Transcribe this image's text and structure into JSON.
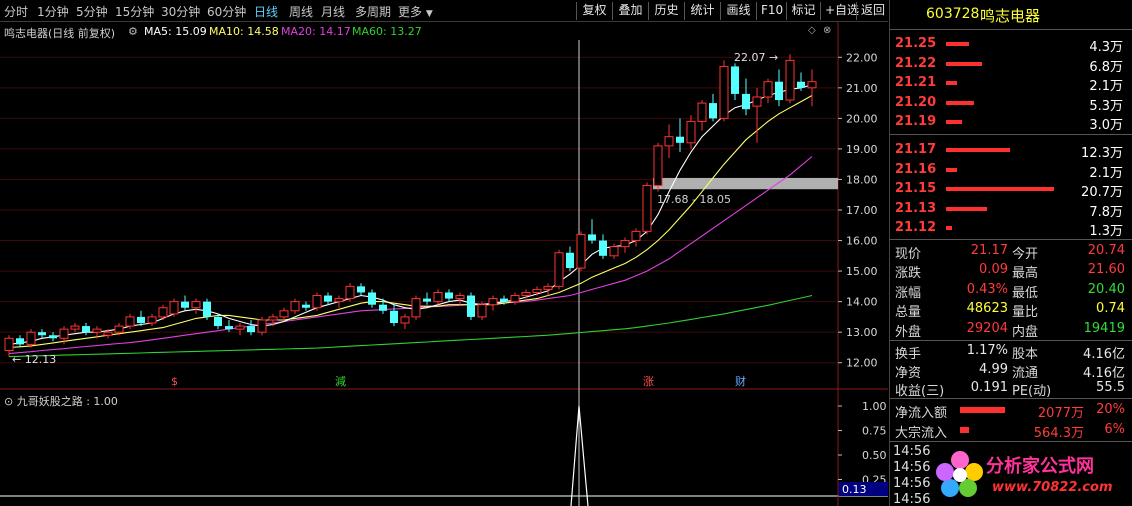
{
  "periods": [
    "分时",
    "1分钟",
    "5分钟",
    "15分钟",
    "30分钟",
    "60分钟",
    "日线",
    "周线",
    "月线",
    "多周期",
    "更多"
  ],
  "active_period": "日线",
  "toolbar": [
    "复权",
    "叠加",
    "历史",
    "统计",
    "画线",
    "F10",
    "标记",
    "+自选",
    "返回"
  ],
  "stock": {
    "code": "603728",
    "name": "鸣志电器",
    "chart_title": "鸣志电器(日线 前复权)"
  },
  "ma": {
    "ma5": {
      "label": "MA5: 15.09",
      "color": "#ffffff"
    },
    "ma10": {
      "label": "MA10: 14.58",
      "color": "#ffff66"
    },
    "ma20": {
      "label": "MA20: 14.17",
      "color": "#e040e0"
    },
    "ma60": {
      "label": "MA60: 13.27",
      "color": "#30d030"
    }
  },
  "annotations": {
    "high": "22.07",
    "low": "12.13",
    "band": "17.68 - 18.05"
  },
  "events": [
    "$",
    "減",
    "涨",
    "财"
  ],
  "indicator": {
    "label": "九哥妖股之路 : 1.00",
    "y_labels": [
      "1.00",
      "0.75",
      "0.50",
      "0.25"
    ],
    "current": "0.13"
  },
  "chart_data": {
    "type": "candlestick",
    "ylim": [
      11.5,
      22.5
    ],
    "y_ticks": [
      "22.00",
      "21.00",
      "20.00",
      "19.00",
      "18.00",
      "17.00",
      "16.00",
      "15.00",
      "14.00",
      "13.00",
      "12.00"
    ],
    "candles": [
      [
        12.4,
        12.9,
        12.2,
        12.8
      ],
      [
        12.8,
        12.9,
        12.5,
        12.6
      ],
      [
        12.6,
        13.1,
        12.5,
        13.0
      ],
      [
        13.0,
        13.1,
        12.8,
        12.9
      ],
      [
        12.9,
        13.0,
        12.7,
        12.8
      ],
      [
        12.8,
        13.2,
        12.6,
        13.1
      ],
      [
        13.1,
        13.3,
        13.0,
        13.2
      ],
      [
        13.2,
        13.3,
        12.9,
        13.0
      ],
      [
        13.0,
        13.2,
        12.8,
        13.1
      ],
      [
        12.9,
        13.1,
        12.8,
        13.0
      ],
      [
        13.0,
        13.3,
        12.9,
        13.2
      ],
      [
        13.2,
        13.6,
        13.1,
        13.5
      ],
      [
        13.5,
        13.7,
        13.2,
        13.3
      ],
      [
        13.3,
        13.6,
        13.2,
        13.5
      ],
      [
        13.5,
        13.9,
        13.4,
        13.8
      ],
      [
        13.6,
        14.1,
        13.5,
        14.0
      ],
      [
        14.0,
        14.2,
        13.7,
        13.8
      ],
      [
        13.8,
        14.1,
        13.6,
        14.0
      ],
      [
        14.0,
        14.1,
        13.4,
        13.5
      ],
      [
        13.5,
        13.6,
        13.1,
        13.2
      ],
      [
        13.2,
        13.4,
        13.0,
        13.1
      ],
      [
        13.1,
        13.3,
        12.9,
        13.2
      ],
      [
        13.2,
        13.4,
        12.9,
        13.0
      ],
      [
        13.0,
        13.5,
        12.9,
        13.4
      ],
      [
        13.4,
        13.6,
        13.2,
        13.5
      ],
      [
        13.5,
        13.8,
        13.4,
        13.7
      ],
      [
        13.7,
        14.1,
        13.6,
        14.0
      ],
      [
        13.9,
        14.0,
        13.7,
        13.8
      ],
      [
        13.8,
        14.3,
        13.7,
        14.2
      ],
      [
        14.2,
        14.3,
        13.9,
        14.0
      ],
      [
        14.0,
        14.2,
        13.8,
        14.1
      ],
      [
        14.1,
        14.6,
        14.0,
        14.5
      ],
      [
        14.5,
        14.6,
        14.2,
        14.3
      ],
      [
        14.3,
        14.4,
        13.8,
        13.9
      ],
      [
        13.9,
        14.1,
        13.6,
        13.7
      ],
      [
        13.7,
        13.9,
        13.2,
        13.3
      ],
      [
        13.3,
        13.6,
        13.1,
        13.5
      ],
      [
        13.5,
        14.2,
        13.4,
        14.1
      ],
      [
        14.1,
        14.3,
        13.9,
        14.0
      ],
      [
        14.0,
        14.4,
        13.9,
        14.3
      ],
      [
        14.3,
        14.4,
        14.0,
        14.1
      ],
      [
        14.1,
        14.3,
        13.9,
        14.2
      ],
      [
        14.2,
        14.3,
        13.4,
        13.5
      ],
      [
        13.5,
        14.0,
        13.4,
        13.9
      ],
      [
        13.9,
        14.2,
        13.7,
        14.1
      ],
      [
        14.1,
        14.2,
        13.9,
        14.0
      ],
      [
        14.0,
        14.3,
        13.9,
        14.2
      ],
      [
        14.2,
        14.4,
        14.1,
        14.3
      ],
      [
        14.3,
        14.5,
        14.2,
        14.4
      ],
      [
        14.4,
        14.6,
        14.2,
        14.5
      ],
      [
        14.5,
        15.7,
        14.4,
        15.6
      ],
      [
        15.6,
        15.8,
        15.0,
        15.1
      ],
      [
        15.1,
        16.3,
        15.0,
        16.2
      ],
      [
        16.2,
        16.7,
        15.9,
        16.0
      ],
      [
        16.0,
        16.2,
        15.4,
        15.5
      ],
      [
        15.5,
        15.9,
        15.4,
        15.8
      ],
      [
        15.8,
        16.1,
        15.6,
        16.0
      ],
      [
        16.0,
        16.4,
        15.8,
        16.3
      ],
      [
        16.3,
        17.9,
        16.2,
        17.8
      ],
      [
        17.8,
        19.2,
        17.6,
        19.1
      ],
      [
        19.1,
        19.8,
        18.7,
        19.4
      ],
      [
        19.4,
        20.0,
        18.9,
        19.2
      ],
      [
        19.2,
        20.1,
        19.0,
        19.9
      ],
      [
        19.9,
        20.6,
        19.6,
        20.5
      ],
      [
        20.5,
        20.8,
        19.9,
        20.0
      ],
      [
        20.0,
        21.9,
        19.9,
        21.7
      ],
      [
        21.7,
        21.8,
        20.6,
        20.8
      ],
      [
        20.8,
        21.3,
        20.1,
        20.3
      ],
      [
        20.4,
        21.0,
        19.2,
        20.7
      ],
      [
        20.7,
        21.3,
        20.5,
        21.2
      ],
      [
        21.2,
        21.6,
        20.4,
        20.6
      ],
      [
        20.6,
        22.1,
        20.5,
        21.9
      ],
      [
        21.2,
        21.5,
        20.9,
        21.0
      ],
      [
        21.0,
        21.6,
        20.4,
        21.2
      ]
    ],
    "ma5": [
      12.6,
      12.65,
      12.7,
      12.8,
      12.85,
      12.9,
      12.95,
      13.0,
      13.0,
      13.05,
      13.1,
      13.2,
      13.25,
      13.3,
      13.45,
      13.6,
      13.7,
      13.75,
      13.7,
      13.6,
      13.45,
      13.35,
      13.25,
      13.2,
      13.25,
      13.35,
      13.5,
      13.65,
      13.8,
      13.9,
      14.0,
      14.1,
      14.2,
      14.15,
      14.05,
      13.9,
      13.8,
      13.75,
      13.8,
      13.9,
      14.0,
      14.05,
      13.95,
      13.9,
      13.95,
      14.0,
      14.05,
      14.15,
      14.25,
      14.35,
      14.65,
      14.9,
      15.2,
      15.55,
      15.75,
      15.8,
      15.85,
      16.0,
      16.3,
      16.85,
      17.6,
      18.3,
      18.9,
      19.4,
      19.75,
      20.1,
      20.35,
      20.45,
      20.6,
      20.75,
      20.85,
      20.95,
      21.0,
      21.1
    ],
    "ma10": [
      12.5,
      12.52,
      12.55,
      12.6,
      12.65,
      12.7,
      12.75,
      12.8,
      12.85,
      12.9,
      12.95,
      13.0,
      13.05,
      13.1,
      13.15,
      13.25,
      13.35,
      13.45,
      13.5,
      13.55,
      13.55,
      13.5,
      13.45,
      13.4,
      13.4,
      13.4,
      13.45,
      13.5,
      13.55,
      13.65,
      13.75,
      13.85,
      13.95,
      14.0,
      14.0,
      13.95,
      13.9,
      13.85,
      13.85,
      13.85,
      13.9,
      13.9,
      13.9,
      13.9,
      13.9,
      13.95,
      14.0,
      14.05,
      14.1,
      14.2,
      14.3,
      14.45,
      14.6,
      14.8,
      14.95,
      15.1,
      15.25,
      15.45,
      15.7,
      16.0,
      16.35,
      16.75,
      17.15,
      17.6,
      18.05,
      18.5,
      18.9,
      19.3,
      19.6,
      19.9,
      20.15,
      20.35,
      20.55,
      20.75
    ],
    "ma20": [
      12.3,
      12.33,
      12.36,
      12.4,
      12.43,
      12.46,
      12.5,
      12.53,
      12.56,
      12.6,
      12.63,
      12.66,
      12.7,
      12.75,
      12.8,
      12.85,
      12.9,
      12.95,
      13.0,
      13.05,
      13.1,
      13.15,
      13.2,
      13.25,
      13.3,
      13.35,
      13.4,
      13.45,
      13.5,
      13.55,
      13.6,
      13.65,
      13.7,
      13.72,
      13.74,
      13.76,
      13.78,
      13.8,
      13.82,
      13.84,
      13.86,
      13.88,
      13.9,
      13.92,
      13.94,
      13.96,
      13.98,
      14.0,
      14.05,
      14.1,
      14.15,
      14.2,
      14.3,
      14.4,
      14.5,
      14.6,
      14.7,
      14.85,
      15.0,
      15.2,
      15.4,
      15.65,
      15.9,
      16.15,
      16.4,
      16.65,
      16.9,
      17.15,
      17.4,
      17.65,
      17.9,
      18.15,
      18.45,
      18.75
    ],
    "ma60": [
      12.2,
      12.21,
      12.22,
      12.23,
      12.24,
      12.25,
      12.26,
      12.27,
      12.28,
      12.29,
      12.3,
      12.31,
      12.32,
      12.33,
      12.34,
      12.35,
      12.36,
      12.37,
      12.38,
      12.39,
      12.4,
      12.41,
      12.42,
      12.43,
      12.44,
      12.45,
      12.46,
      12.47,
      12.48,
      12.5,
      12.52,
      12.54,
      12.56,
      12.58,
      12.6,
      12.62,
      12.64,
      12.66,
      12.68,
      12.7,
      12.72,
      12.74,
      12.76,
      12.78,
      12.8,
      12.82,
      12.84,
      12.86,
      12.88,
      12.9,
      12.93,
      12.96,
      12.99,
      13.02,
      13.05,
      13.08,
      13.11,
      13.15,
      13.2,
      13.25,
      13.3,
      13.36,
      13.42,
      13.48,
      13.54,
      13.6,
      13.67,
      13.74,
      13.81,
      13.88,
      13.96,
      14.04,
      14.12,
      14.2
    ],
    "indicator_values": [
      0,
      0,
      0,
      0,
      0,
      0,
      0,
      0,
      0,
      0,
      0,
      0,
      0,
      0,
      0,
      0,
      0,
      0,
      0,
      0,
      0,
      0,
      0,
      0,
      0,
      0,
      0,
      0,
      0,
      0,
      0,
      0,
      0,
      0,
      0,
      0,
      0,
      0,
      0,
      0,
      0,
      0,
      0,
      0,
      0,
      0,
      0,
      0,
      0,
      0,
      0,
      0,
      1.0,
      0,
      0,
      0,
      0,
      0,
      0,
      0,
      0,
      0,
      0,
      0,
      0,
      0,
      0,
      0,
      0,
      0,
      0,
      0,
      0,
      0
    ]
  },
  "order_book": {
    "asks": [
      {
        "price": "21.25",
        "vol": "4.3万",
        "w": 0.21
      },
      {
        "price": "21.22",
        "vol": "6.8万",
        "w": 0.33
      },
      {
        "price": "21.21",
        "vol": "2.1万",
        "w": 0.1
      },
      {
        "price": "21.20",
        "vol": "5.3万",
        "w": 0.26
      },
      {
        "price": "21.19",
        "vol": "3.0万",
        "w": 0.15
      }
    ],
    "bids": [
      {
        "price": "21.17",
        "vol": "12.3万",
        "w": 0.59
      },
      {
        "price": "21.16",
        "vol": "2.1万",
        "w": 0.1
      },
      {
        "price": "21.15",
        "vol": "20.7万",
        "w": 1.0
      },
      {
        "price": "21.13",
        "vol": "7.8万",
        "w": 0.38
      },
      {
        "price": "21.12",
        "vol": "1.3万",
        "w": 0.06
      }
    ]
  },
  "quote": [
    {
      "l1": "现价",
      "v1": "21.17",
      "c1": "#ff3b3b",
      "l2": "今开",
      "v2": "20.74",
      "c2": "#ff3b3b"
    },
    {
      "l1": "涨跌",
      "v1": "0.09",
      "c1": "#ff3b3b",
      "l2": "最高",
      "v2": "21.60",
      "c2": "#ff3b3b"
    },
    {
      "l1": "涨幅",
      "v1": "0.43%",
      "c1": "#ff3b3b",
      "l2": "最低",
      "v2": "20.40",
      "c2": "#33dd33"
    },
    {
      "l1": "总量",
      "v1": "48623",
      "c1": "#ffff33",
      "l2": "量比",
      "v2": "0.74",
      "c2": "#ffff33"
    },
    {
      "l1": "外盘",
      "v1": "29204",
      "c1": "#ff3b3b",
      "l2": "内盘",
      "v2": "19419",
      "c2": "#33dd33"
    }
  ],
  "stats": [
    {
      "l1": "换手",
      "v1": "1.17%",
      "l2": "股本",
      "v2": "4.16亿"
    },
    {
      "l1": "净资",
      "v1": "4.99",
      "l2": "流通",
      "v2": "4.16亿"
    },
    {
      "l1": "收益(三)",
      "v1": "0.191",
      "l2": "PE(动)",
      "v2": "55.5"
    }
  ],
  "flows": [
    {
      "label": "净流入额",
      "value": "2077万",
      "pct": "20%",
      "w": 0.82
    },
    {
      "label": "大宗流入",
      "value": "564.3万",
      "pct": "6%",
      "w": 0.16
    }
  ],
  "ticks": [
    "14:56",
    "14:56",
    "14:56",
    "14:56"
  ],
  "watermark": {
    "name": "分析家公式网",
    "url": "www.70822.com"
  }
}
